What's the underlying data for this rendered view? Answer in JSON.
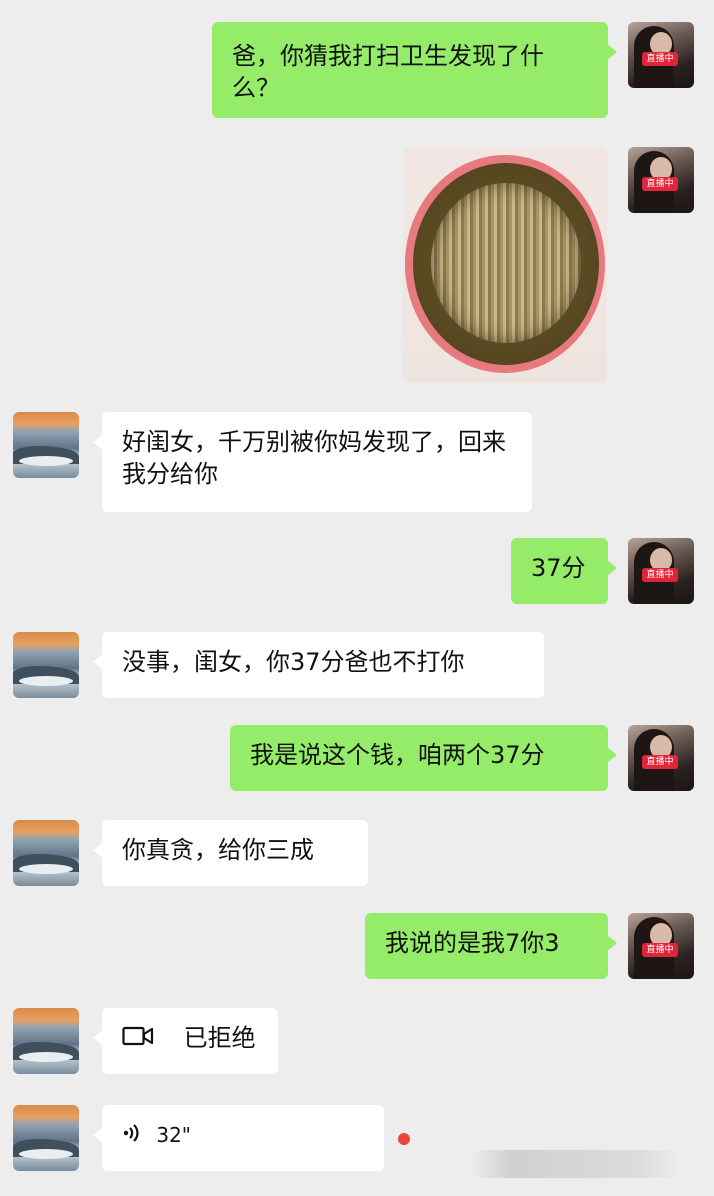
{
  "messages": [
    {
      "text": "爸，你猜我打扫卫生发现了什么？"
    },
    {
      "text": "好闺女，千万别被你妈发现了，回来我分给你"
    },
    {
      "text": "37分"
    },
    {
      "text": "没事，闺女，你37分爸也不打你"
    },
    {
      "text": "我是说这个钱，咱两个37分"
    },
    {
      "text": "你真贪，给你三成"
    },
    {
      "text": "我说的是我7你3"
    },
    {
      "text": "已拒绝"
    },
    {
      "text": "32\""
    }
  ],
  "avatar_badge": "直播中",
  "colors": {
    "background": "#ededed",
    "sent_bubble": "#95ec69",
    "received_bubble": "#ffffff",
    "unread_dot": "#e8463f",
    "badge": "#e0243a"
  },
  "icons": {
    "video_call": "video-camera-icon",
    "voice": "voice-wave-icon"
  }
}
